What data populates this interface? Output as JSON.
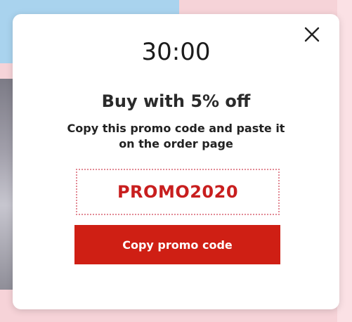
{
  "popup": {
    "timer": "30:00",
    "headline": "Buy with 5% off",
    "subtext": "Copy this promo code and paste it on the order page",
    "promo_code": "PROMO2020",
    "copy_button_label": "Copy promo code",
    "close_icon": "close-icon"
  },
  "colors": {
    "accent_red": "#cf1f14",
    "promo_text": "#c81e1e",
    "dotted_border": "#e28a95",
    "overlay_pink": "#f6d3d8"
  }
}
